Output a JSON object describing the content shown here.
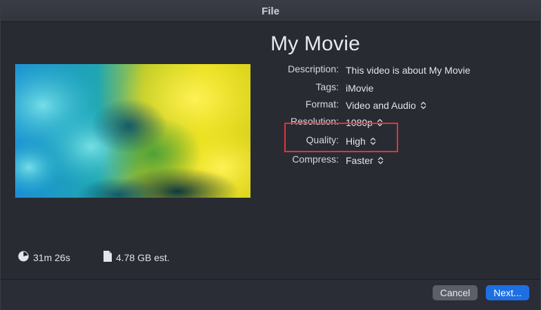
{
  "window": {
    "title": "File"
  },
  "movie": {
    "title": "My Movie"
  },
  "fields": {
    "description": {
      "label": "Description:",
      "value": "This video is about My Movie"
    },
    "tags": {
      "label": "Tags:",
      "value": "iMovie"
    },
    "format": {
      "label": "Format:",
      "value": "Video and Audio"
    },
    "resolution": {
      "label": "Resolution:",
      "value": "1080p"
    },
    "quality": {
      "label": "Quality:",
      "value": "High"
    },
    "compress": {
      "label": "Compress:",
      "value": "Faster"
    }
  },
  "stats": {
    "duration": "31m 26s",
    "size": "4.78 GB est."
  },
  "buttons": {
    "cancel": "Cancel",
    "next": "Next..."
  },
  "colors": {
    "highlight_box": "#e2343b",
    "primary_button": "#1e6fe3",
    "secondary_button": "#5c5f68"
  },
  "icons": {
    "duration": "clock-icon",
    "size": "document-icon",
    "stepper": "up-down-chevron-icon"
  }
}
